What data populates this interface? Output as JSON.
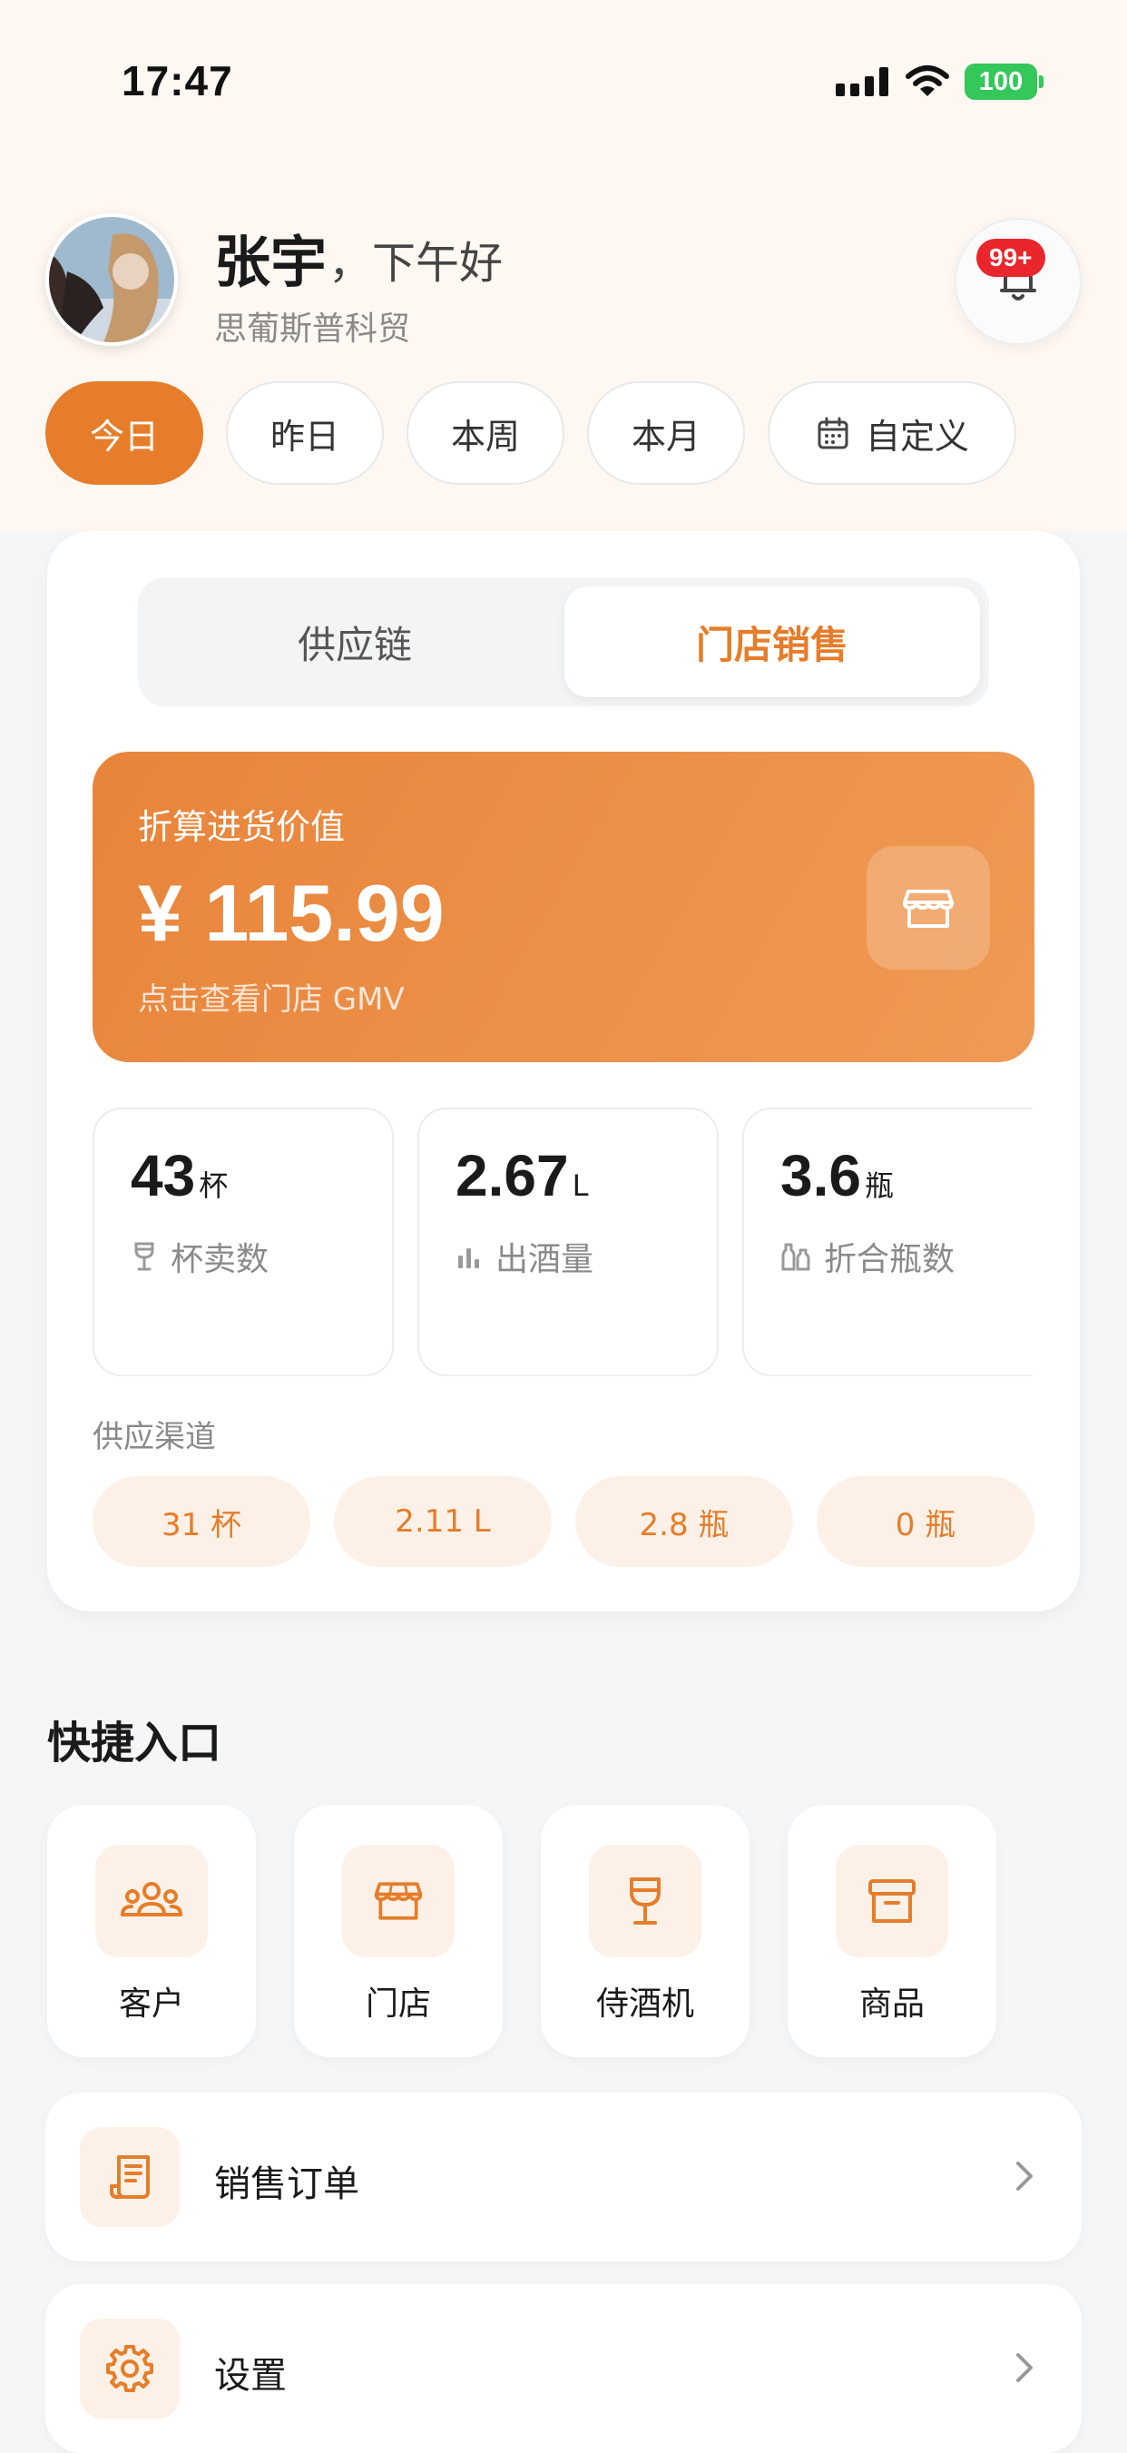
{
  "status_bar": {
    "time": "17:47",
    "battery": "100"
  },
  "profile": {
    "name": "张宇",
    "greeting": "，下午好",
    "company": "思葡斯普科贸",
    "notification_badge": "99+"
  },
  "date_filters": [
    {
      "label": "今日",
      "active": true
    },
    {
      "label": "昨日",
      "active": false
    },
    {
      "label": "本周",
      "active": false
    },
    {
      "label": "本月",
      "active": false
    },
    {
      "label": "自定义",
      "active": false
    }
  ],
  "segment_tabs": [
    {
      "label": "供应链",
      "active": false
    },
    {
      "label": "门店销售",
      "active": true
    }
  ],
  "value_card": {
    "label": "折算进货价值",
    "amount": "¥ 115.99",
    "subtitle": "点击查看门店 GMV"
  },
  "metrics": [
    {
      "value": "43",
      "unit": "杯",
      "label": "杯卖数",
      "icon": "wine-glass-icon"
    },
    {
      "value": "2.67",
      "unit": "L",
      "label": "出酒量",
      "icon": "bar-chart-icon"
    },
    {
      "value": "3.6",
      "unit": "瓶",
      "label": "折合瓶数",
      "icon": "bottles-icon"
    }
  ],
  "supply_channels": {
    "title": "供应渠道",
    "values": [
      "31 杯",
      "2.11 L",
      "2.8 瓶",
      "0 瓶"
    ]
  },
  "quick_entry": {
    "title": "快捷入口",
    "items": [
      {
        "label": "客户",
        "icon": "customers-icon"
      },
      {
        "label": "门店",
        "icon": "store-icon"
      },
      {
        "label": "侍酒机",
        "icon": "wine-dispenser-icon"
      },
      {
        "label": "商品",
        "icon": "product-box-icon"
      }
    ]
  },
  "menu_list": [
    {
      "label": "销售订单",
      "icon": "receipt-icon"
    },
    {
      "label": "设置",
      "icon": "gear-icon"
    }
  ],
  "colors": {
    "accent": "#e57d2a",
    "accent_soft": "#fdf1e7",
    "badge": "#e8262b",
    "battery": "#34c759"
  }
}
